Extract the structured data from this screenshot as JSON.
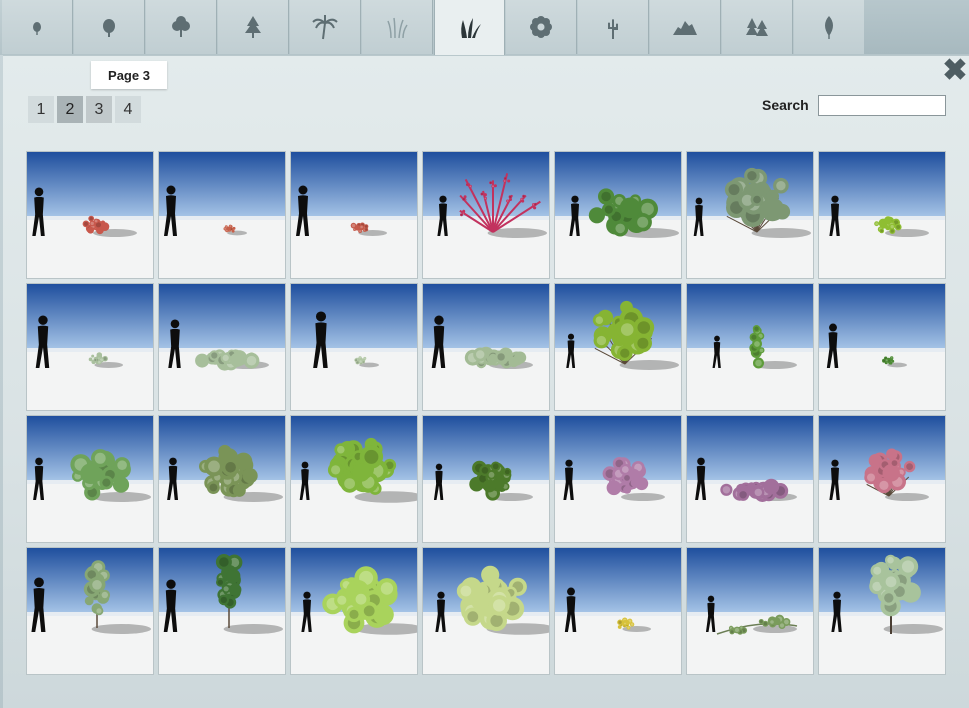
{
  "category_tabs": [
    {
      "name": "tab-small-tree",
      "icon": "small-tree-icon",
      "active": false
    },
    {
      "name": "tab-round-tree",
      "icon": "round-tree-icon",
      "active": false
    },
    {
      "name": "tab-broadleaf-tree",
      "icon": "broadleaf-tree-icon",
      "active": false
    },
    {
      "name": "tab-conifer",
      "icon": "conifer-icon",
      "active": false
    },
    {
      "name": "tab-palm",
      "icon": "palm-icon",
      "active": false
    },
    {
      "name": "tab-grass",
      "icon": "grass-icon",
      "active": false
    },
    {
      "name": "tab-shrub",
      "icon": "shrub-icon",
      "active": true
    },
    {
      "name": "tab-flower",
      "icon": "flower-icon",
      "active": false
    },
    {
      "name": "tab-cactus",
      "icon": "cactus-icon",
      "active": false
    },
    {
      "name": "tab-rock",
      "icon": "rock-icon",
      "active": false
    },
    {
      "name": "tab-forest",
      "icon": "forest-icon",
      "active": false
    },
    {
      "name": "tab-leaf",
      "icon": "leaf-icon",
      "active": false
    }
  ],
  "pager": {
    "tooltip": "Page 3",
    "pages": [
      "1",
      "2",
      "3",
      "4"
    ],
    "current_page": "2",
    "hover_page": "3"
  },
  "search": {
    "label": "Search",
    "value": "",
    "placeholder": ""
  },
  "close_icon": "close-icon",
  "colors": {
    "sky_top": "#1f4f9e",
    "sky_bottom": "#a8c6e8",
    "ground": "#f3f4f4",
    "silhouette": "#0d0d0d"
  },
  "plants": [
    {
      "id": "shrub-red-low",
      "color": "#c8584c",
      "shape": "mound",
      "scale": "medium"
    },
    {
      "id": "shrub-red-tiny",
      "color": "#c6604a",
      "shape": "mound",
      "scale": "tiny"
    },
    {
      "id": "shrub-red-small",
      "color": "#c45a4a",
      "shape": "mound",
      "scale": "small"
    },
    {
      "id": "shrub-pink-branching",
      "color": "#c2325e",
      "shape": "branching",
      "scale": "large"
    },
    {
      "id": "shrub-green-leafy",
      "color": "#4f8a3a",
      "shape": "leafy",
      "scale": "large"
    },
    {
      "id": "shrub-grey-green-airy",
      "color": "#7d9873",
      "shape": "airy",
      "scale": "large"
    },
    {
      "id": "shrub-yellow-green",
      "color": "#8fbe32",
      "shape": "mound",
      "scale": "medium"
    },
    {
      "id": "shrub-sage-small",
      "color": "#a9c09e",
      "shape": "mound",
      "scale": "small"
    },
    {
      "id": "shrub-sage-hedge",
      "color": "#a7bf9b",
      "shape": "hedge",
      "scale": "medium"
    },
    {
      "id": "shrub-sage-tiny",
      "color": "#b1c6a4",
      "shape": "mound",
      "scale": "tiny"
    },
    {
      "id": "shrub-sage-long",
      "color": "#a3bb95",
      "shape": "hedge",
      "scale": "medium"
    },
    {
      "id": "shrub-lime-tall",
      "color": "#86b433",
      "shape": "airy",
      "scale": "large"
    },
    {
      "id": "shrub-vine-column",
      "color": "#5e9c3a",
      "shape": "column",
      "scale": "medium"
    },
    {
      "id": "shrub-ground-cover",
      "color": "#4d8b35",
      "shape": "mound",
      "scale": "tiny"
    },
    {
      "id": "shrub-light-green-spread",
      "color": "#6fa35a",
      "shape": "leafy",
      "scale": "large"
    },
    {
      "id": "shrub-olive-round",
      "color": "#7a9457",
      "shape": "round",
      "scale": "large"
    },
    {
      "id": "shrub-bright-round",
      "color": "#7fb53b",
      "shape": "round",
      "scale": "xlarge"
    },
    {
      "id": "shrub-dark-green-round",
      "color": "#4c7a2a",
      "shape": "round",
      "scale": "medium"
    },
    {
      "id": "shrub-lilac",
      "color": "#b07ca8",
      "shape": "round",
      "scale": "medium"
    },
    {
      "id": "shrub-lilac-wide",
      "color": "#a26f9b",
      "shape": "hedge",
      "scale": "medium"
    },
    {
      "id": "shrub-pink-airy",
      "color": "#c87389",
      "shape": "airy",
      "scale": "medium"
    },
    {
      "id": "shrub-slim-tree-pale",
      "color": "#87a774",
      "shape": "slim",
      "scale": "large"
    },
    {
      "id": "shrub-slim-tree-dark",
      "color": "#3f7434",
      "shape": "slim",
      "scale": "large"
    },
    {
      "id": "shrub-lime-big",
      "color": "#a9d35c",
      "shape": "round",
      "scale": "xlarge"
    },
    {
      "id": "shrub-pale-lime-big",
      "color": "#c5d88a",
      "shape": "round",
      "scale": "xlarge"
    },
    {
      "id": "shrub-yellow-flower",
      "color": "#d7c23a",
      "shape": "mound",
      "scale": "small"
    },
    {
      "id": "shrub-creeping-vine",
      "color": "#7a9c5c",
      "shape": "creeping",
      "scale": "medium"
    },
    {
      "id": "shrub-grey-tree",
      "color": "#a8c39c",
      "shape": "tree",
      "scale": "large"
    }
  ]
}
